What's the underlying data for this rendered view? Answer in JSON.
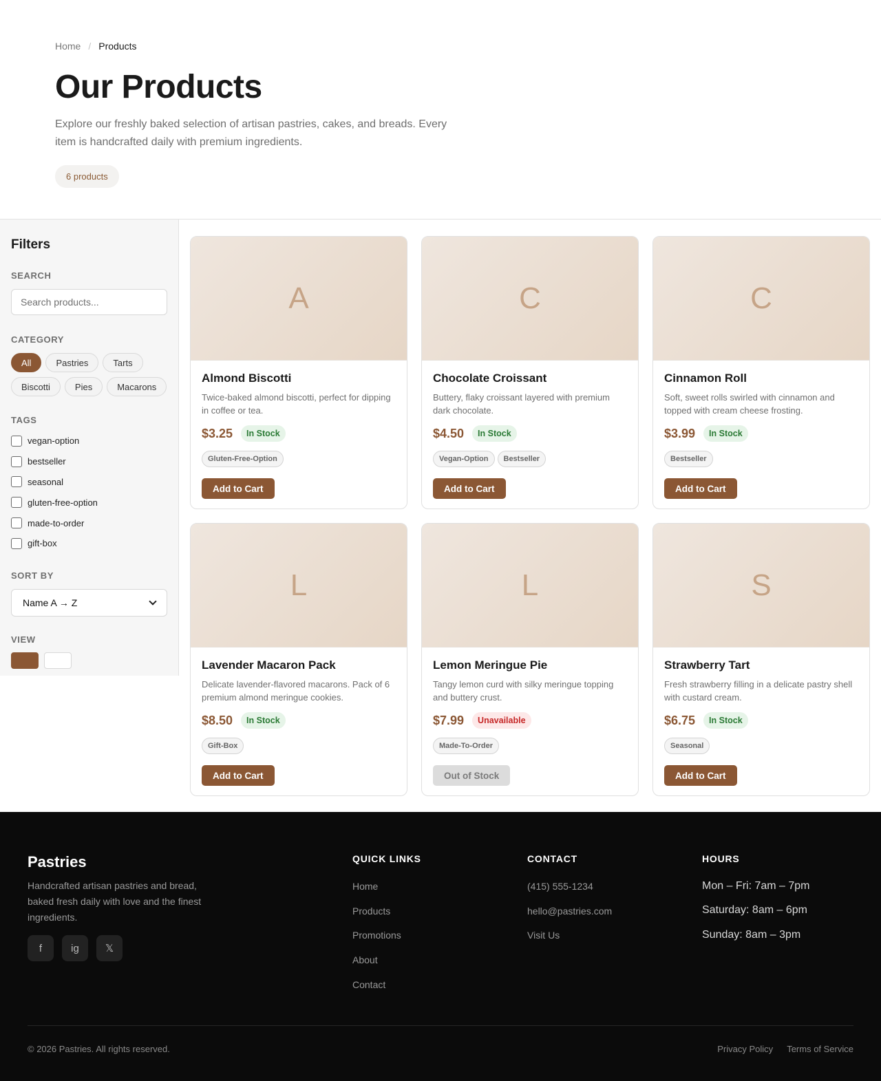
{
  "breadcrumb": {
    "home": "Home",
    "separator": "/",
    "current": "Products"
  },
  "hero": {
    "title": "Our Products",
    "description": "Explore our freshly baked selection of artisan pastries, cakes, and breads. Every item is handcrafted daily with premium ingredients.",
    "count_badge": "6 products"
  },
  "filters": {
    "title": "Filters",
    "search": {
      "label": "Search",
      "placeholder": "Search products..."
    },
    "category": {
      "label": "Category",
      "options": [
        "All",
        "Pastries",
        "Tarts",
        "Biscotti",
        "Pies",
        "Macarons"
      ],
      "selected": "All"
    },
    "tags": {
      "label": "Tags",
      "options": [
        "vegan-option",
        "bestseller",
        "seasonal",
        "gluten-free-option",
        "made-to-order",
        "gift-box"
      ]
    },
    "sort": {
      "label": "Sort By",
      "value": "Name A → Z"
    },
    "view": {
      "label": "View"
    }
  },
  "products": [
    {
      "letter": "A",
      "name": "Almond Biscotti",
      "description": "Twice-baked almond biscotti, perfect for dipping in coffee or tea.",
      "price": "$3.25",
      "stock": "In Stock",
      "tags": [
        "Gluten-Free-Option"
      ],
      "button": "Add to Cart"
    },
    {
      "letter": "C",
      "name": "Chocolate Croissant",
      "description": "Buttery, flaky croissant layered with premium dark chocolate.",
      "price": "$4.50",
      "stock": "In Stock",
      "tags": [
        "Vegan-Option",
        "Bestseller"
      ],
      "button": "Add to Cart"
    },
    {
      "letter": "C",
      "name": "Cinnamon Roll",
      "description": "Soft, sweet rolls swirled with cinnamon and topped with cream cheese frosting.",
      "price": "$3.99",
      "stock": "In Stock",
      "tags": [
        "Bestseller"
      ],
      "button": "Add to Cart"
    },
    {
      "letter": "L",
      "name": "Lavender Macaron Pack",
      "description": "Delicate lavender-flavored macarons. Pack of 6 premium almond meringue cookies.",
      "price": "$8.50",
      "stock": "In Stock",
      "tags": [
        "Gift-Box"
      ],
      "button": "Add to Cart"
    },
    {
      "letter": "L",
      "name": "Lemon Meringue Pie",
      "description": "Tangy lemon curd with silky meringue topping and buttery crust.",
      "price": "$7.99",
      "stock": "Unavailable",
      "tags": [
        "Made-To-Order"
      ],
      "button": "Out of Stock"
    },
    {
      "letter": "S",
      "name": "Strawberry Tart",
      "description": "Fresh strawberry filling in a delicate pastry shell with custard cream.",
      "price": "$6.75",
      "stock": "In Stock",
      "tags": [
        "Seasonal"
      ],
      "button": "Add to Cart"
    }
  ],
  "footer": {
    "brand": "Pastries",
    "description": "Handcrafted artisan pastries and bread, baked fresh daily with love and the finest ingredients.",
    "socials": [
      {
        "label": "f",
        "icon": "facebook-icon"
      },
      {
        "label": "ig",
        "icon": "instagram-icon"
      },
      {
        "label": "𝕏",
        "icon": "x-twitter-icon"
      }
    ],
    "quick_links": {
      "title": "Quick Links",
      "items": [
        "Home",
        "Products",
        "Promotions",
        "About",
        "Contact"
      ]
    },
    "contact": {
      "title": "Contact",
      "items": [
        "(415) 555-1234",
        "hello@pastries.com",
        "Visit Us"
      ]
    },
    "hours": {
      "title": "Hours",
      "items": [
        "Mon – Fri: 7am – 7pm",
        "Saturday: 8am – 6pm",
        "Sunday: 8am – 3pm"
      ]
    },
    "copyright": "© 2026 Pastries. All rights reserved.",
    "legal": [
      "Privacy Policy",
      "Terms of Service"
    ]
  },
  "colors": {
    "accent": "#8b5734",
    "in_stock_bg": "#e6f4e8",
    "in_stock_text": "#2b7a35",
    "unavailable_bg": "#fde8e8",
    "unavailable_text": "#c62828",
    "footer_bg": "#0b0b0b"
  }
}
